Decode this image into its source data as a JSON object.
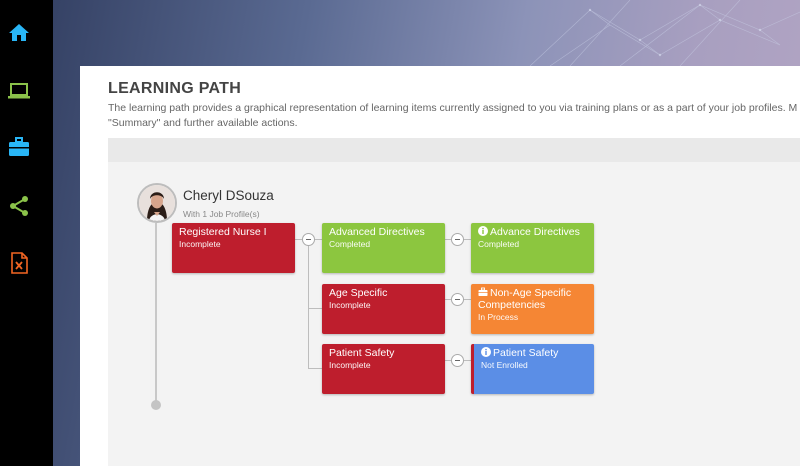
{
  "sidebar": {
    "items": [
      {
        "icon": "home-icon",
        "color": "#29b6f6"
      },
      {
        "icon": "laptop-icon",
        "color": "#8bc34a"
      },
      {
        "icon": "briefcase-icon",
        "color": "#29b6f6"
      },
      {
        "icon": "share-icon",
        "color": "#8bc34a"
      },
      {
        "icon": "excel-file-icon",
        "color": "#f26522"
      }
    ]
  },
  "page": {
    "title": "LEARNING PATH",
    "description_line1": "The learning path provides a graphical representation of learning items currently assigned to you via training plans or as a part of your job profiles. M",
    "description_line2": "\"Summary\" and further available actions."
  },
  "person": {
    "name": "Cheryl DSouza",
    "subtitle": "With 1 Job Profile(s)"
  },
  "tree": {
    "root": {
      "title": "Registered Nurse I",
      "status": "Incomplete",
      "color": "#be1e2d"
    },
    "level2": [
      {
        "title": "Advanced Directives",
        "status": "Completed",
        "color": "#8cc63f"
      },
      {
        "title": "Age Specific",
        "status": "Incomplete",
        "color": "#be1e2d"
      },
      {
        "title": "Patient Safety",
        "status": "Incomplete",
        "color": "#be1e2d"
      }
    ],
    "level3": [
      {
        "title": "Advance Directives",
        "status": "Completed",
        "icon": "info-icon",
        "color": "#8cc63f"
      },
      {
        "title": "Non-Age Specific Competencies",
        "status": "In Process",
        "icon": "briefcase-icon",
        "color": "#f58634"
      },
      {
        "title": "Patient Safety",
        "status": "Not Enrolled",
        "icon": "info-icon",
        "color": "#5b8ee6"
      }
    ]
  }
}
